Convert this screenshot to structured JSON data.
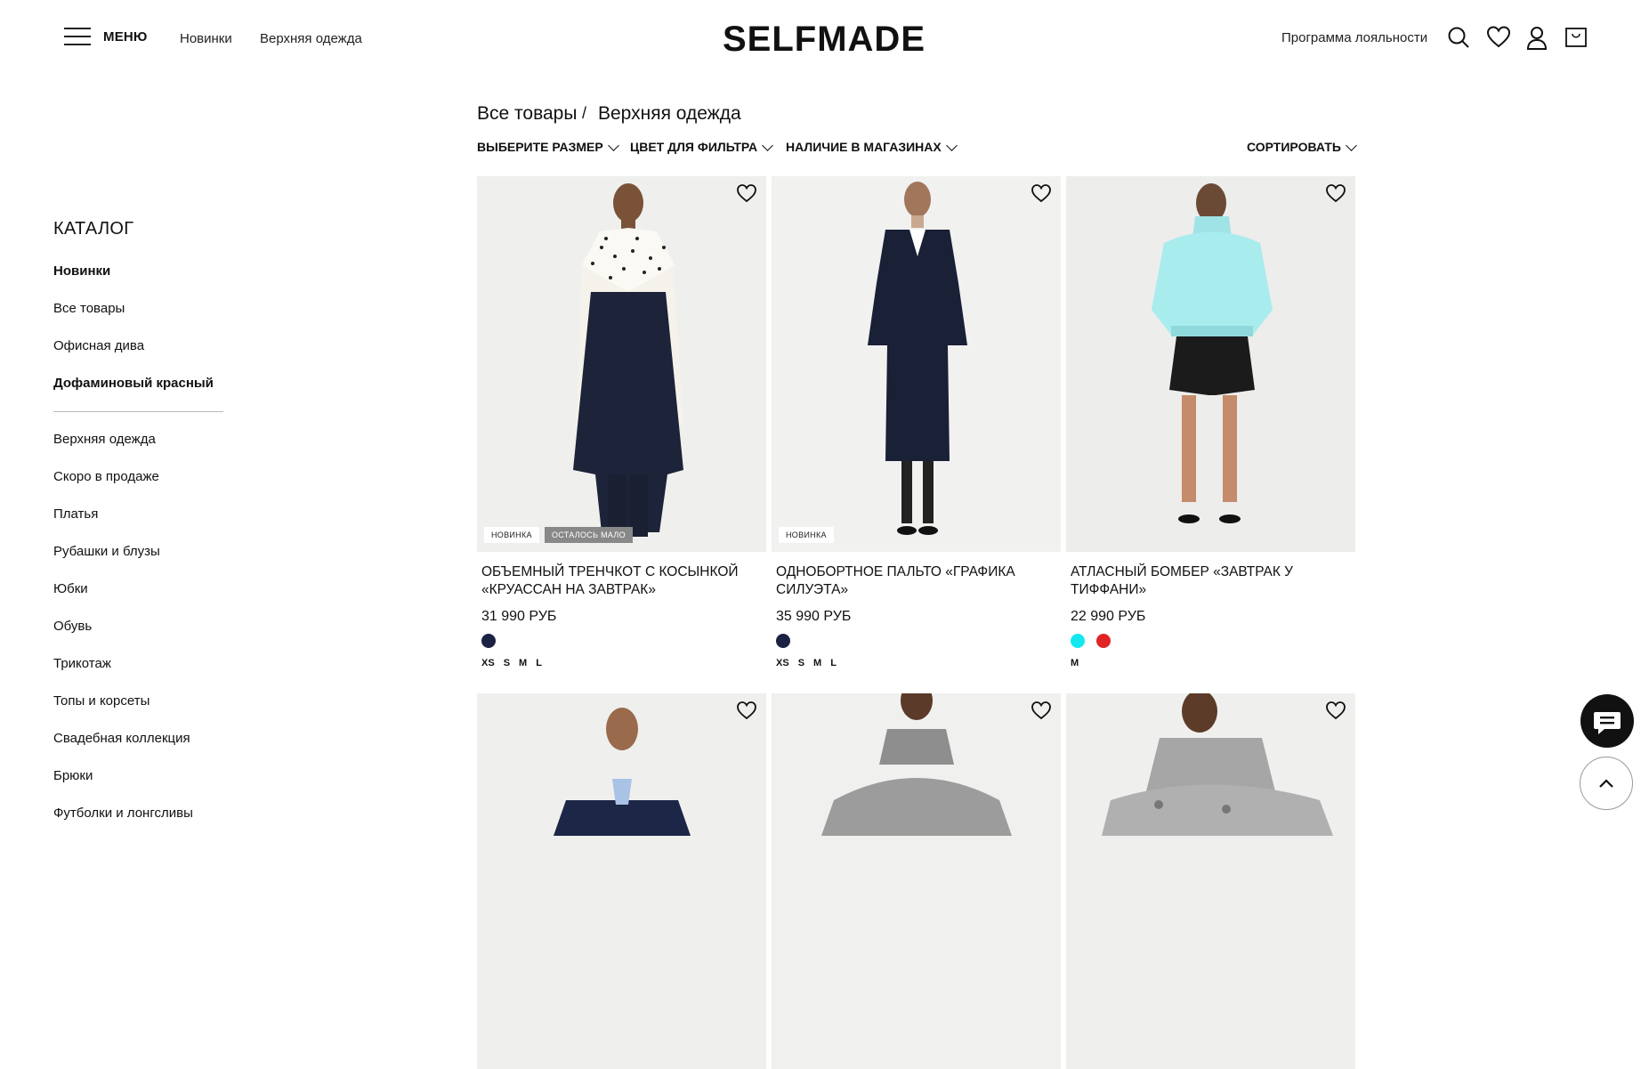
{
  "header": {
    "menu_label": "МЕНЮ",
    "nav": [
      "Новинки",
      "Верхняя одежда"
    ],
    "logo": "SELFMADE",
    "loyalty": "Программа лояльности"
  },
  "sidebar": {
    "title": "КАТАЛОГ",
    "top_items": [
      {
        "label": "Новинки",
        "bold": true
      },
      {
        "label": "Все товары",
        "bold": false
      },
      {
        "label": "Офисная дива",
        "bold": false
      },
      {
        "label": "Дофаминовый красный",
        "bold": true
      }
    ],
    "items": [
      "Верхняя одежда",
      "Скоро в продаже",
      "Платья",
      "Рубашки и блузы",
      "Юбки",
      "Обувь",
      "Трикотаж",
      "Топы и корсеты",
      "Свадебная коллекция",
      "Брюки",
      "Футболки и лонгсливы"
    ]
  },
  "breadcrumb": {
    "root": "Все товары",
    "separator": "/",
    "current": "Верхняя одежда"
  },
  "filters": {
    "size": "ВЫБЕРИТЕ РАЗМЕР",
    "color": "ЦВЕТ ДЛЯ ФИЛЬТРА",
    "stores": "НАЛИЧИЕ В МАГАЗИНАХ",
    "sort": "СОРТИРОВАТЬ"
  },
  "products": [
    {
      "title": "ОБЪЕМНЫЙ ТРЕНЧКОТ С КОСЫНКОЙ «КРУАССАН НА ЗАВТРАК»",
      "price": "31 990 РУБ",
      "badges": [
        "НОВИНКА",
        "ОСТАЛОСЬ МАЛО"
      ],
      "colors": [
        "#1b2244"
      ],
      "sizes": [
        "XS",
        "S",
        "M",
        "L"
      ]
    },
    {
      "title": "ОДНОБОРТНОЕ ПАЛЬТО «ГРАФИКА СИЛУЭТА»",
      "price": "35 990 РУБ",
      "badges": [
        "НОВИНКА"
      ],
      "colors": [
        "#1b2244"
      ],
      "sizes": [
        "XS",
        "S",
        "M",
        "L"
      ]
    },
    {
      "title": "АТЛАСНЫЙ БОМБЕР «ЗАВТРАК У ТИФФАНИ»",
      "price": "22 990 РУБ",
      "badges": [],
      "colors": [
        "#13e8ee",
        "#e02424"
      ],
      "sizes": [
        "M"
      ]
    },
    {
      "title": "",
      "price": "",
      "badges": [],
      "colors": [],
      "sizes": []
    },
    {
      "title": "",
      "price": "",
      "badges": [],
      "colors": [],
      "sizes": []
    },
    {
      "title": "",
      "price": "",
      "badges": [],
      "colors": [],
      "sizes": []
    }
  ],
  "icons": {
    "search": "search-icon",
    "wishlist": "heart-icon",
    "account": "user-icon",
    "cart": "cart-icon",
    "chat": "chat-icon",
    "scroll_top": "chevron-up-icon"
  }
}
